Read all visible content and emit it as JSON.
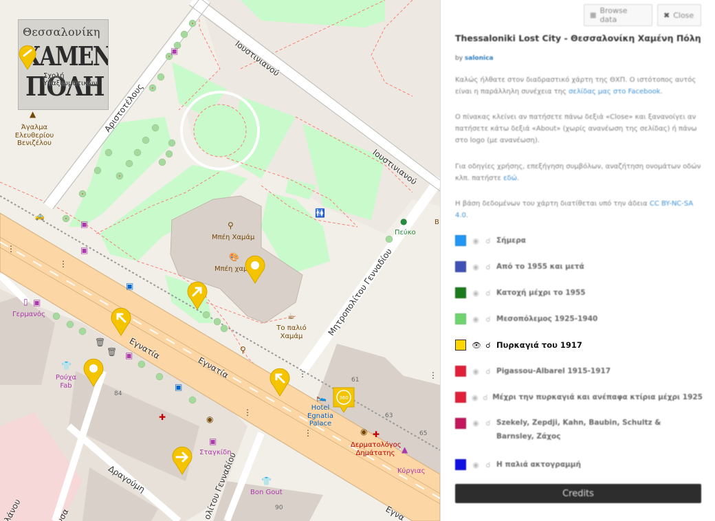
{
  "panel": {
    "browse_label": "Browse data",
    "close_label": "Close",
    "title": "Thessaloniki Lost City - Θεσσαλονίκη Χαμένη Πόλη",
    "by_prefix": "by",
    "author": "salonica",
    "p1": "Καλώς ήλθατε στον διαδραστικό χάρτη της ΘΧΠ. Ο ιστότοπος αυτός είναι η παράλληλη συνέχεια της",
    "p1_link": "σελίδας μας στο Facebook",
    "p1_end": ".",
    "p2": "Ο πίνακας κλείνει αν πατήσετε πάνω δεξιά «Close» και ξανανοίγει αν πατήσετε κάτω δεξιά «About» (χωρίς ανανέωση της σελίδας) ή πάνω στο logo (με ανανέωση).",
    "p3": "Για οδηγίες χρήσης, επεξήγηση συμβόλων, αναζήτηση ονομάτων οδών κλπ. πατήστε",
    "p3_link": "εδώ",
    "p3_end": ".",
    "p4": "Η βάση δεδομένων του χάρτη διατίθεται υπό την άδεια",
    "p4_link": "CC BY-NC-SA 4.0",
    "p4_end": ".",
    "credits_label": "Credits",
    "layers": [
      {
        "name": "Σήμερα",
        "color": "#2196f3"
      },
      {
        "name": "Από το 1955 και μετά",
        "color": "#3f51b5"
      },
      {
        "name": "Κατοχή μέχρι το 1955",
        "color": "#1b7a1b"
      },
      {
        "name": "Μεσοπόλεμος 1925-1940",
        "color": "#6fd46f"
      },
      {
        "name": "Πυρκαγιά του 1917",
        "color": "#ffd600"
      },
      {
        "name": "Pigassou-Albarel 1915-1917",
        "color": "#e0203a"
      },
      {
        "name": "Μέχρι την πυρκαγιά και ανέπαφα κτίρια μέχρι 1925",
        "color": "#e0203a"
      },
      {
        "name": "Szekely, Zepdji, Kahn, Baubin, Schultz & Barnsley, Ζάχος",
        "color": "#c2185b"
      },
      {
        "name": "Η παλιά ακτογραμμή",
        "color": "#1010e0"
      }
    ]
  },
  "logo": {
    "line1": "Θεσσαλονίκη",
    "line2": "ΧΑΜΕΝΗ",
    "line3": "ΠΟΛΗ",
    "overlay_text": "Σχολή Υπαξιωματικών"
  },
  "map": {
    "streets": {
      "ioustinianou_1": "Ιουστινιανού",
      "ioustinianou_2": "Ιουστινιανού",
      "aristotelous": "Αριστοτέλους",
      "egnatia_1": "Εγνατία",
      "egnatia_2": "Εγνατία",
      "mitropolitou": "Μητροπολίτου Γενναδίου",
      "mitropolitou_2": "ολίτου Γενναδίου",
      "dragoumi": "Δραγούμη",
      "bottom_left": "λάνου",
      "bottom_left_2": "νσα",
      "bottom_right": "Εγνα"
    },
    "pois": {
      "statue": "Άγαλμα Ελευθερίου Βενιζέλου",
      "bey_hamam_1": "Μπέη Χαμάμ",
      "bey_hamam_2": "Μπέη χαμ",
      "palio_hamam": "Το παλιό Χαμάμ",
      "pefko": "Πεύκο",
      "germanos": "Γερμανός",
      "rouxa_fab": "Ρούχα Fab",
      "stagkidi": "Σταγκίδη",
      "hotel": "Hotel Egnatia Palace",
      "dermatologos": "Δερματολόγος Δημάτατης",
      "kyrgias": "Κύργιας",
      "bon_gout": "Bon Gout",
      "edge_b": "Β"
    },
    "house_numbers": [
      "61",
      "63",
      "65",
      "84",
      "90"
    ]
  },
  "colors": {
    "marker": "#f5c400",
    "road_major": "#fcd6a4",
    "park": "#c8facc",
    "building": "#d9d0c9",
    "path_red": "#fa8072"
  }
}
